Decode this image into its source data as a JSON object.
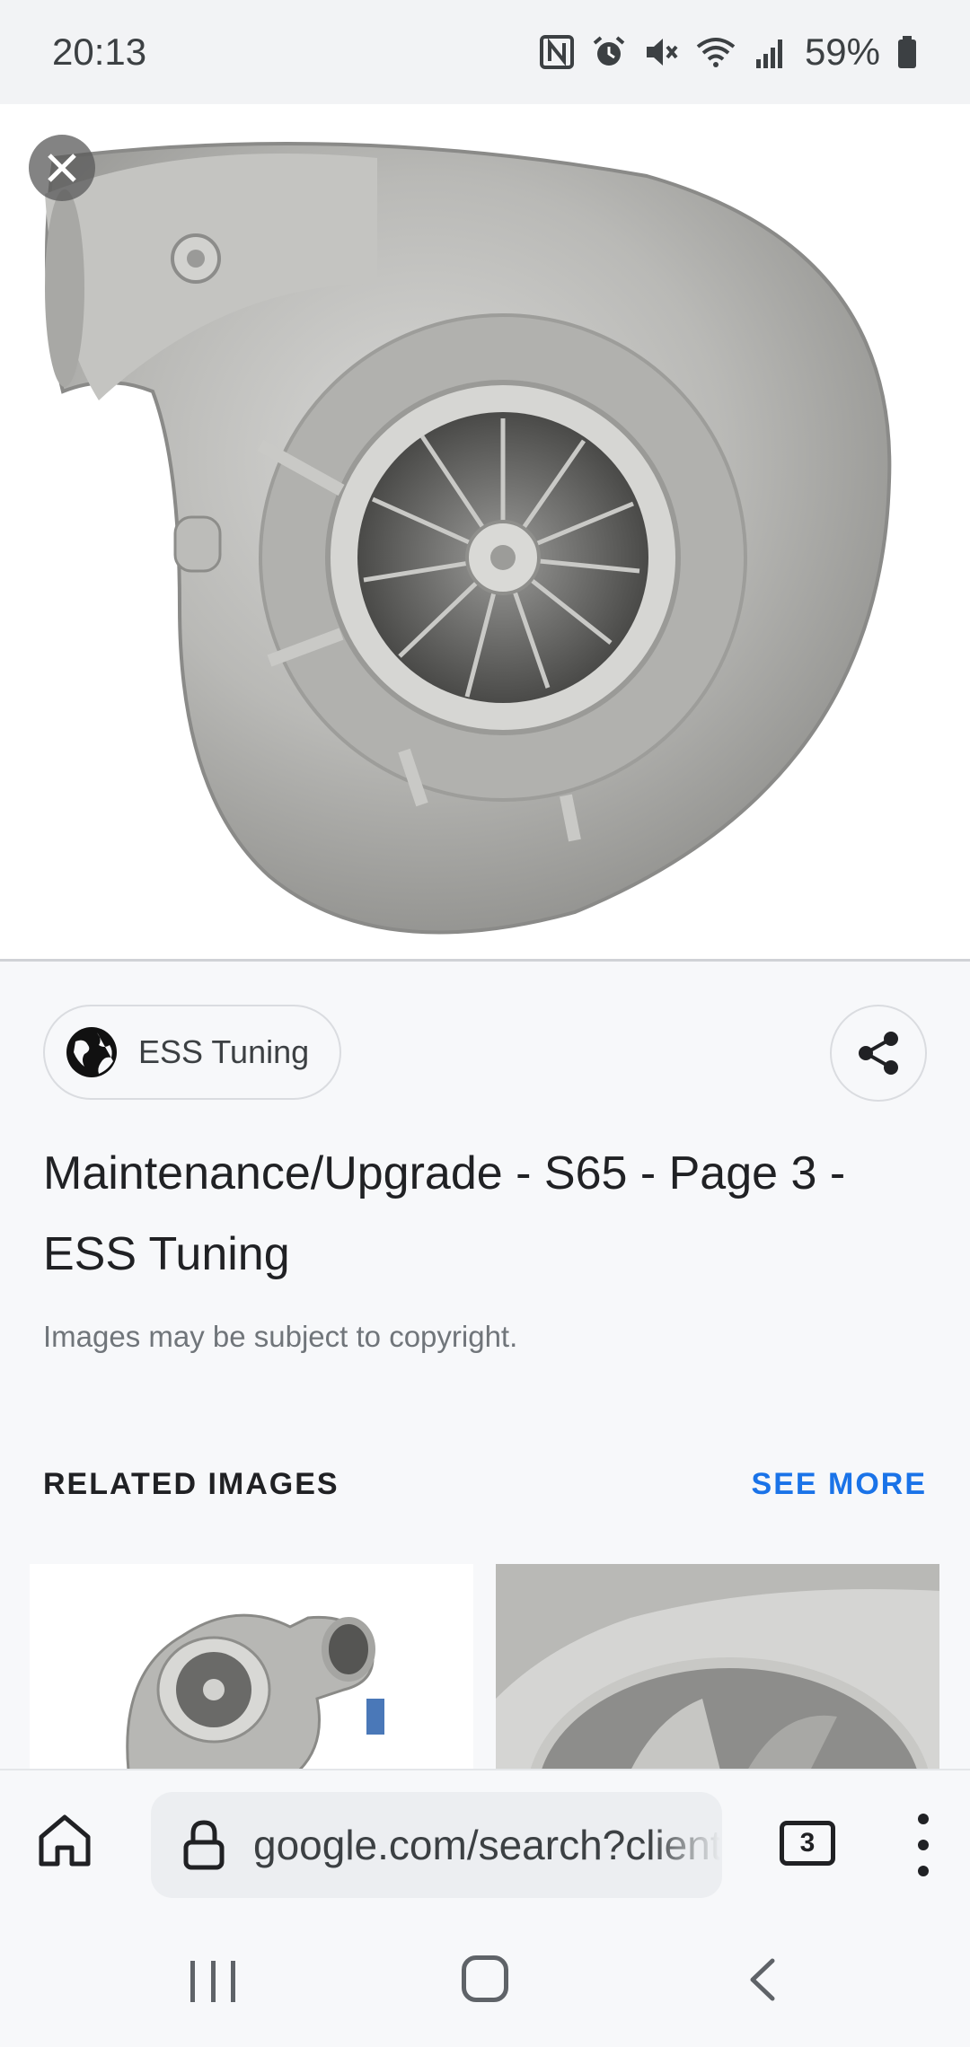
{
  "status_bar": {
    "time": "20:13",
    "battery": "59%",
    "icons": [
      "nfc-icon",
      "alarm-icon",
      "mute-icon",
      "wifi-icon",
      "signal-icon",
      "battery-icon"
    ]
  },
  "viewer": {
    "close_icon": "close-icon",
    "image_subject": "turbocharger compressor housing"
  },
  "source": {
    "name": "ESS Tuning",
    "icon": "globe-icon"
  },
  "share_icon": "share-icon",
  "title": "Maintenance/Upgrade - S65 - Page 3 - ESS Tuning",
  "copyright_notice": "Images may be subject to copyright.",
  "related": {
    "label": "RELATED IMAGES",
    "see_more": "SEE MORE"
  },
  "browser_bar": {
    "home_icon": "home-icon",
    "lock_icon": "lock-icon",
    "url": "google.com/search?client=",
    "tab_count": "3",
    "menu_icon": "more-vert-icon"
  },
  "nav_bar": {
    "buttons": [
      "recent-apps-icon",
      "home-icon",
      "back-icon"
    ]
  },
  "colors": {
    "accent": "#1a73e8",
    "background": "#f7f8fa"
  }
}
